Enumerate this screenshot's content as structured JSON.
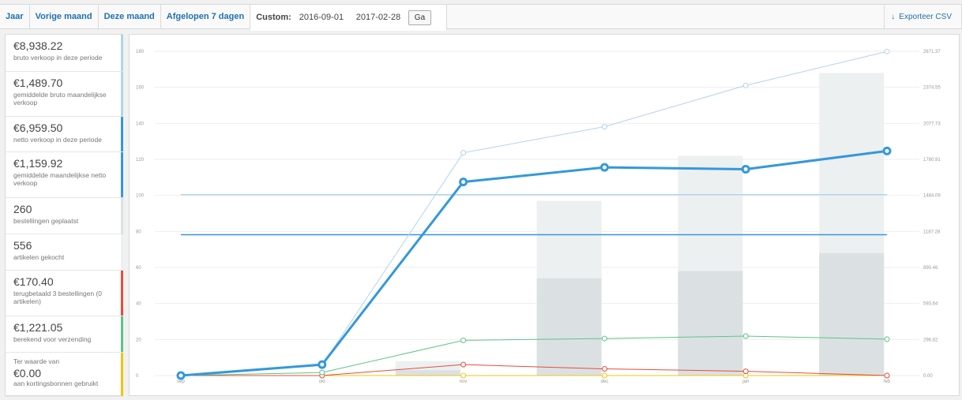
{
  "tabs": {
    "year": "Jaar",
    "last_month": "Vorige maand",
    "this_month": "Deze maand",
    "last_7_days": "Afgelopen 7 dagen",
    "custom_label": "Custom:",
    "start_date": "2016-09-01",
    "end_date": "2017-02-28",
    "go_button": "Ga",
    "export_label": "Exporteer CSV"
  },
  "legend": [
    {
      "value": "€8,938.22",
      "label": "bruto verkoop in deze periode",
      "color": "#b1d4ea"
    },
    {
      "value": "€1,489.70",
      "label": "gemiddelde bruto maandelijkse verkoop",
      "color": "#b1d4ea"
    },
    {
      "value": "€6,959.50",
      "label": "netto verkoop in deze periode",
      "color": "#3498db"
    },
    {
      "value": "€1,159.92",
      "label": "gemiddelde maandelijkse netto verkoop",
      "color": "#3498db"
    },
    {
      "value": "260",
      "label": "bestellingen geplaatst",
      "color": "#dbe1e3"
    },
    {
      "value": "556",
      "label": "artikelen gekocht",
      "color": "#ecf0f1"
    },
    {
      "value": "€170.40",
      "label": "terugbetaald 3 bestellingen (0 artikelen)",
      "color": "#e74c3c"
    },
    {
      "value": "€1,221.05",
      "label": "berekend voor verzending",
      "color": "#5cc488"
    },
    {
      "value": "€0.00",
      "pre_label": "Ter waarde van",
      "label": "aan kortingsbonnen gebruikt",
      "color": "#f1c40f"
    }
  ],
  "chart_data": {
    "type": "bar+line",
    "categories": [
      "sep",
      "okt",
      "nov",
      "dec",
      "jan",
      "feb"
    ],
    "left_ticks": [
      "0",
      "20",
      "40",
      "60",
      "80",
      "100",
      "120",
      "140",
      "160",
      "180"
    ],
    "right_ticks": [
      "0.00",
      "296.82",
      "593.64",
      "890.46",
      "1187.28",
      "1484.09",
      "1780.91",
      "2077.73",
      "2374.55",
      "2671.37"
    ],
    "ylim_left": [
      0,
      180
    ],
    "ylim_right": [
      0,
      2671.37
    ],
    "items_bars": [
      0,
      8,
      97,
      122,
      168,
      160
    ],
    "orders_bars": [
      0,
      3,
      54,
      58,
      68,
      75
    ],
    "gross_sales": [
      0,
      85,
      1835,
      2050,
      2390,
      2670
    ],
    "net_sales": [
      0,
      90,
      1595,
      1715,
      1700,
      1850
    ],
    "shipping": [
      0,
      25,
      290,
      305,
      325,
      300
    ],
    "refunds": [
      0,
      0,
      90,
      55,
      35,
      0
    ],
    "coupons": [
      0,
      0,
      0,
      0,
      0,
      0
    ],
    "avg_gross": 1489.7,
    "avg_net": 1159.92,
    "colors": {
      "gross": "#b1d4ea",
      "net": "#3498db",
      "shipping": "#5cc488",
      "refunds": "#e74c3c",
      "coupons": "#f1c40f",
      "items": "#ecf0f1",
      "orders": "#dbe1e3"
    }
  }
}
